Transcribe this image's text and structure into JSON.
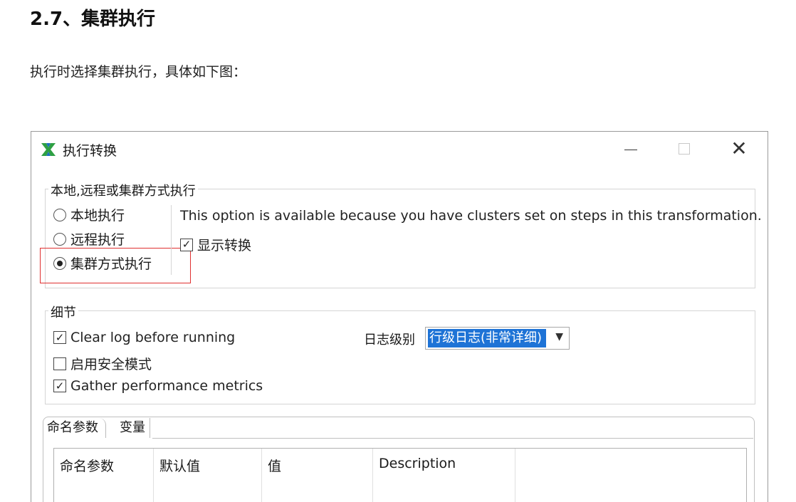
{
  "doc": {
    "heading": "2.7、集群执行",
    "paragraph": "执行时选择集群执行，具体如下图："
  },
  "dialog": {
    "title": "执行转换",
    "app_icon": "kettle-spoon-icon",
    "window_controls": {
      "minimize": "minimize-icon",
      "maximize": "maximize-icon",
      "close": "close-icon"
    },
    "execution_group": {
      "legend": "本地,远程或集群方式执行",
      "options": [
        {
          "label": "本地执行",
          "selected": false
        },
        {
          "label": "远程执行",
          "selected": false
        },
        {
          "label": "集群方式执行",
          "selected": true
        }
      ],
      "cluster_note": "This option is available because you have clusters set on steps in this transformation.",
      "show_transform": {
        "label": "显示转换",
        "checked": true
      }
    },
    "details_group": {
      "legend": "细节",
      "checkboxes": [
        {
          "label": "Clear log before running",
          "checked": true
        },
        {
          "label": "启用安全模式",
          "checked": false
        },
        {
          "label": "Gather performance metrics",
          "checked": true
        }
      ],
      "log_level_label": "日志级别",
      "log_level_value": "行级日志(非常详细)"
    },
    "tabs": [
      {
        "label": "命名参数",
        "active": true
      },
      {
        "label": "变量",
        "active": false
      }
    ],
    "table_headers": [
      "命名参数",
      "默认值",
      "值",
      "Description"
    ],
    "colors": {
      "selection": "#1e73d6",
      "highlight_border": "#e03030"
    }
  }
}
